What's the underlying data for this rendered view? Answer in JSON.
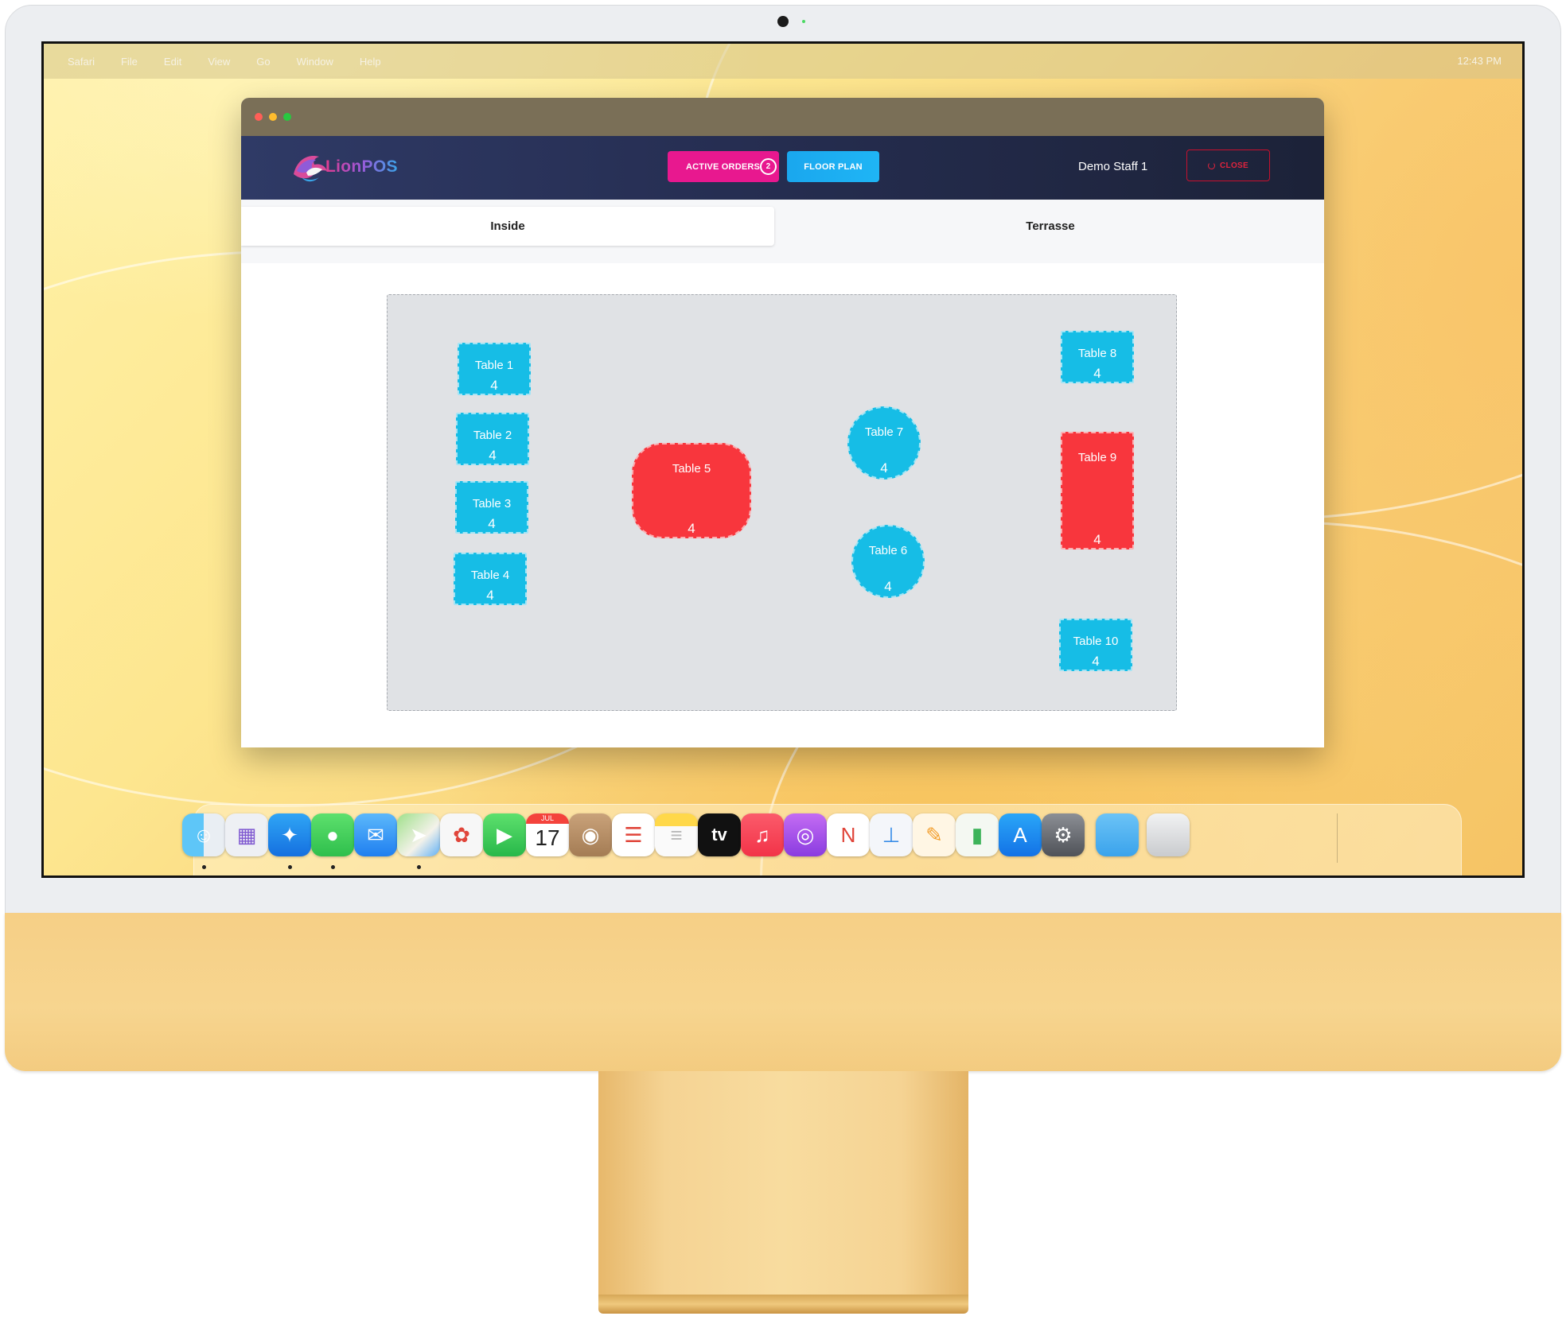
{
  "menubar": {
    "items": [
      "Safari",
      "File",
      "Edit",
      "View",
      "Go",
      "Window",
      "Help"
    ],
    "clock": "12:43 PM"
  },
  "app": {
    "brand": "LionPOS",
    "active_orders_label": "ACTIVE ORDERS",
    "active_orders_count": "2",
    "floor_plan_label": "FLOOR PLAN",
    "staff_name": "Demo Staff 1",
    "close_label": "CLOSE"
  },
  "tabs": [
    "Inside",
    "Terrasse"
  ],
  "tables": [
    {
      "name": "Table 1",
      "seats": "4",
      "shape": "rect",
      "status": "free"
    },
    {
      "name": "Table 2",
      "seats": "4",
      "shape": "rect",
      "status": "free"
    },
    {
      "name": "Table 3",
      "seats": "4",
      "shape": "rect",
      "status": "free"
    },
    {
      "name": "Table 4",
      "seats": "4",
      "shape": "rect",
      "status": "free"
    },
    {
      "name": "Table 5",
      "seats": "4",
      "shape": "rounded",
      "status": "occupied"
    },
    {
      "name": "Table 6",
      "seats": "4",
      "shape": "circle",
      "status": "free"
    },
    {
      "name": "Table 7",
      "seats": "4",
      "shape": "circle",
      "status": "free"
    },
    {
      "name": "Table 8",
      "seats": "4",
      "shape": "rect",
      "status": "free"
    },
    {
      "name": "Table 9",
      "seats": "4",
      "shape": "rect",
      "status": "occupied"
    },
    {
      "name": "Table 10",
      "seats": "4",
      "shape": "rect",
      "status": "free"
    }
  ],
  "colors": {
    "free": "#16bde6",
    "occupied": "#f8363d",
    "accent_pink": "#e8188f",
    "accent_blue": "#1fb5f5",
    "close_red": "#e0233d"
  },
  "dock": {
    "apps": [
      {
        "icon": "finder-icon"
      },
      {
        "icon": "launchpad-icon"
      },
      {
        "icon": "safari-icon"
      },
      {
        "icon": "messages-icon"
      },
      {
        "icon": "mail-icon"
      },
      {
        "icon": "maps-icon"
      },
      {
        "icon": "photos-icon"
      },
      {
        "icon": "facetime-icon"
      },
      {
        "icon": "calendar-icon",
        "month": "JUL",
        "day": "17"
      },
      {
        "icon": "contacts-icon"
      },
      {
        "icon": "reminders-icon"
      },
      {
        "icon": "notes-icon"
      },
      {
        "icon": "apple-tv-icon",
        "label": "tv"
      },
      {
        "icon": "music-icon"
      },
      {
        "icon": "podcasts-icon"
      },
      {
        "icon": "news-icon"
      },
      {
        "icon": "keynote-icon"
      },
      {
        "icon": "pages-icon"
      },
      {
        "icon": "numbers-icon"
      },
      {
        "icon": "app-store-icon"
      },
      {
        "icon": "system-preferences-icon"
      },
      {
        "icon": "folder-icon"
      },
      {
        "icon": "trash-icon"
      }
    ]
  }
}
